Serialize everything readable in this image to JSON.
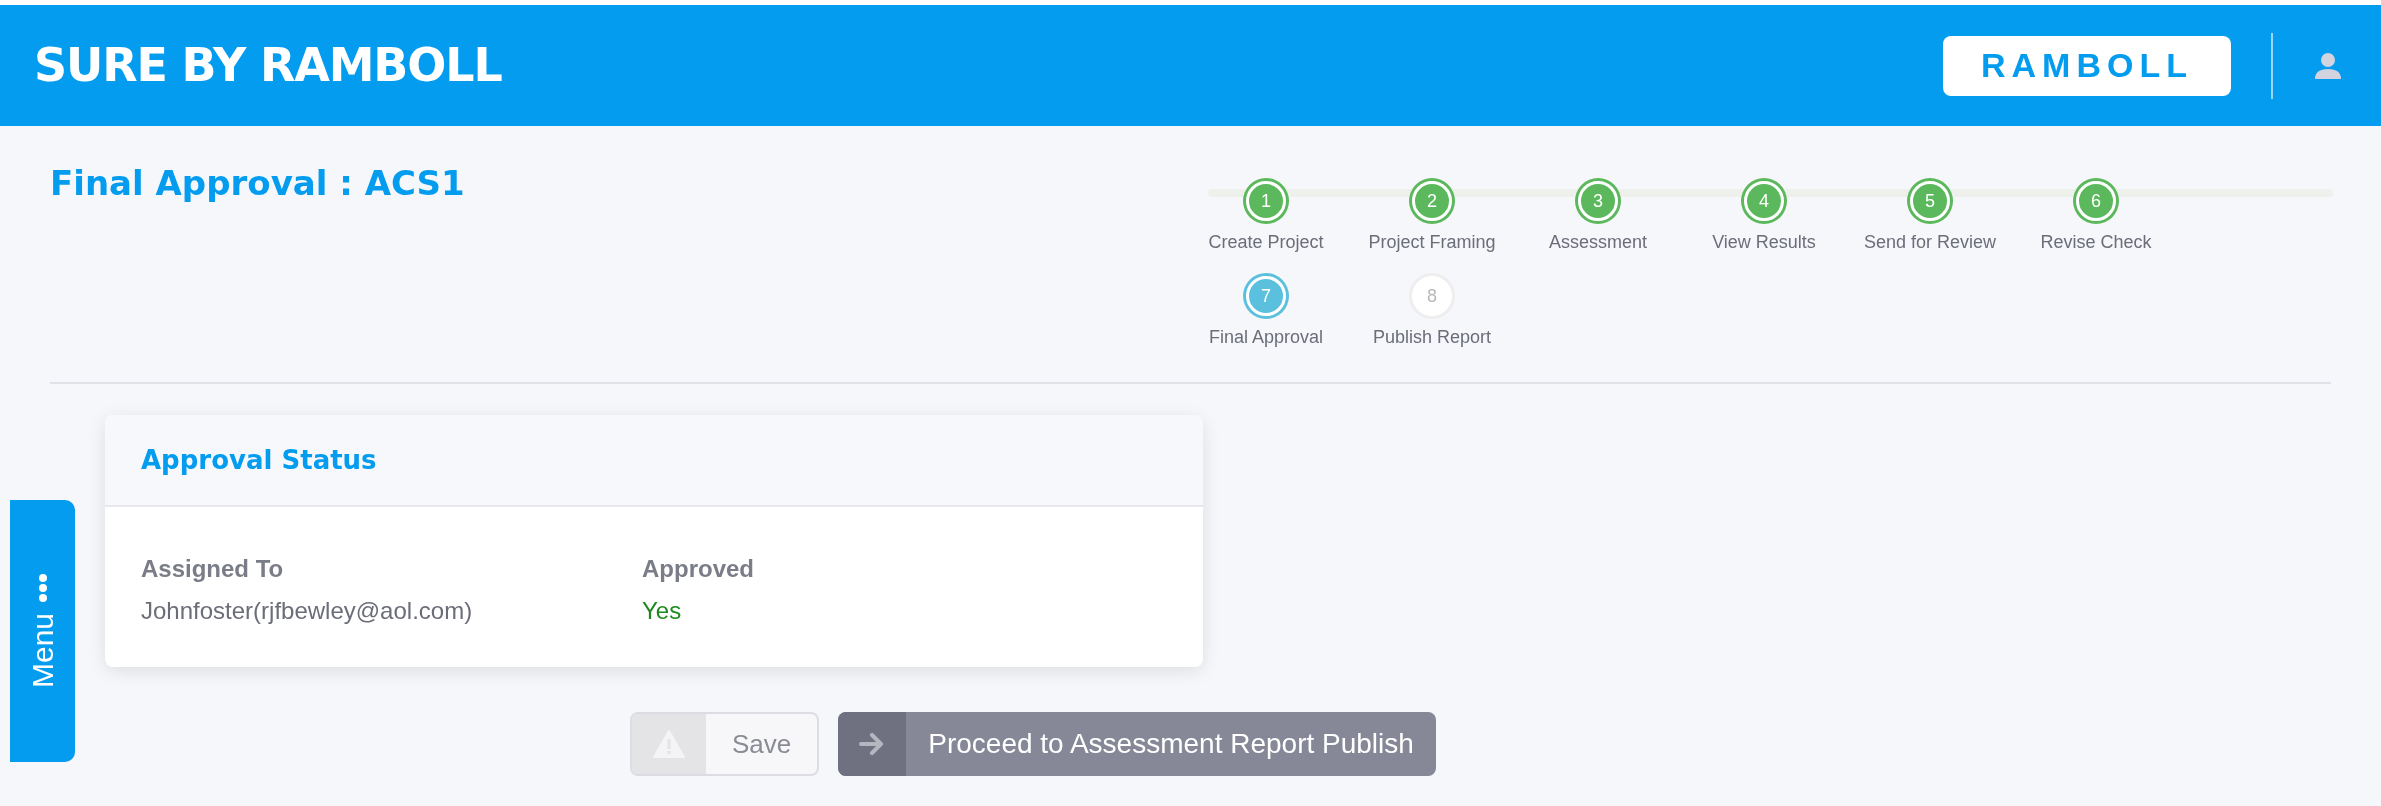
{
  "header": {
    "title": "SURE BY RAMBOLL",
    "logo": "RAMBOLL"
  },
  "page_title": "Final Approval : ACS1",
  "steps": [
    {
      "number": "1",
      "label": "Create Project",
      "kind": "completed"
    },
    {
      "number": "2",
      "label": "Project Framing",
      "kind": "completed"
    },
    {
      "number": "3",
      "label": "Assessment",
      "kind": "completed"
    },
    {
      "number": "4",
      "label": "View Results",
      "kind": "completed"
    },
    {
      "number": "5",
      "label": "Send for Review",
      "kind": "completed"
    },
    {
      "number": "6",
      "label": "Revise Check",
      "kind": "completed"
    },
    {
      "number": "7",
      "label": "Final Approval",
      "kind": "current"
    },
    {
      "number": "8",
      "label": "Publish Report",
      "kind": "pending"
    }
  ],
  "side_menu": {
    "label": "Menu"
  },
  "card": {
    "title": "Approval Status",
    "fields": [
      {
        "label": "Assigned To",
        "value": "Johnfoster(rjfbewley@aol.com)",
        "kind": "plain"
      },
      {
        "label": "Approved",
        "value": "Yes",
        "kind": "positive"
      }
    ]
  },
  "buttons": [
    {
      "label": "Save",
      "kind": "warning",
      "disabled": true
    },
    {
      "label": "Proceed to Assessment Report Publish",
      "kind": "proceed",
      "disabled": false
    }
  ]
}
